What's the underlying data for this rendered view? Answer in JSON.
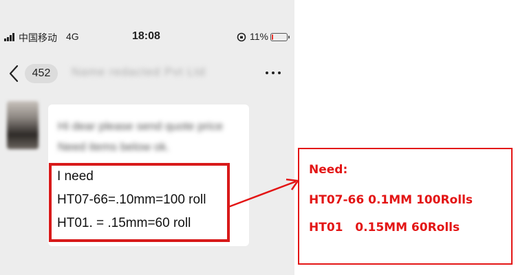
{
  "status_bar": {
    "carrier": "中国移动",
    "network": "4G",
    "time": "18:08",
    "battery": "11%",
    "battery_level": 0.11
  },
  "nav": {
    "unread_count": "452",
    "title": "Name redacted Pvt Ltd"
  },
  "message": {
    "blurred_lines": [
      "Hi dear please send quote price",
      "Need items below ok."
    ],
    "lines": [
      "I need",
      "HT07-66=.10mm=100 roll",
      "HT01. = .15mm=60 roll"
    ]
  },
  "annotation": {
    "lines": [
      "Need:",
      "HT07-66 0.1MM 100Rolls",
      "HT01   0.15MM 60Rolls"
    ]
  },
  "colors": {
    "accent_red": "#e31515",
    "highlight_red": "#d81a1a",
    "chat_background": "#ededed",
    "bubble": "#ffffff"
  }
}
